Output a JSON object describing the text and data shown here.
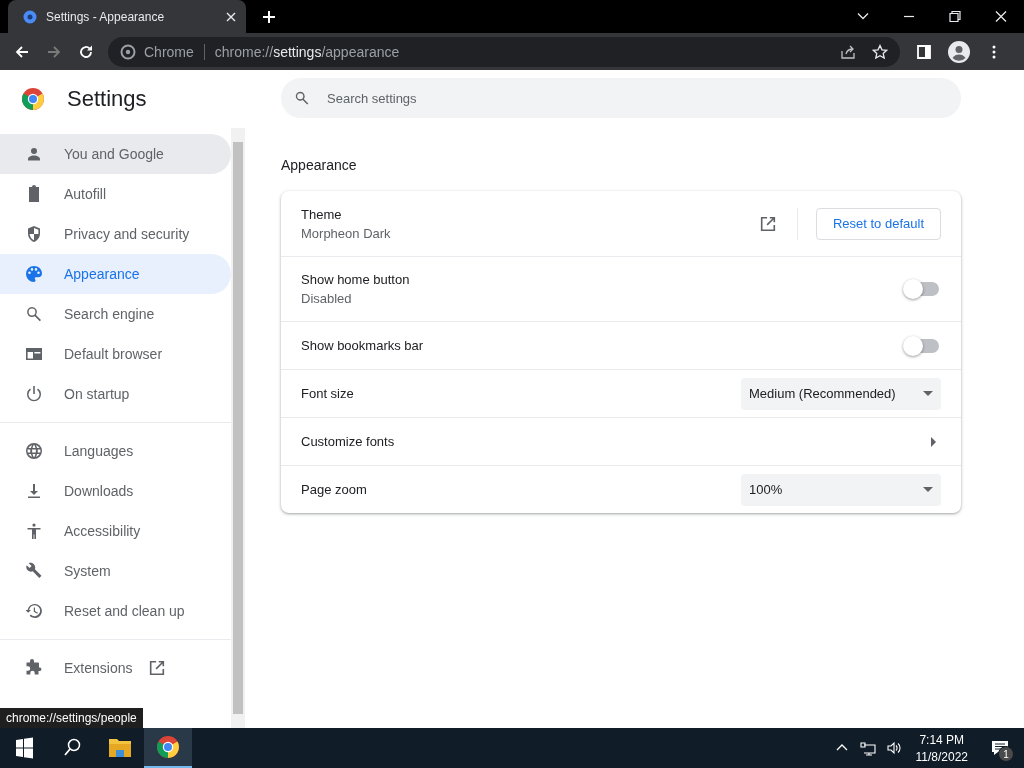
{
  "browser": {
    "tab": {
      "title": "Settings - Appearance"
    },
    "address_bar": {
      "chip": "Chrome",
      "url": {
        "scheme": "chrome://",
        "host": "settings",
        "path": "/appearance"
      }
    }
  },
  "sidebar": {
    "title": "Settings",
    "sections": [
      {
        "items": [
          {
            "label": "You and Google",
            "selected": false,
            "hovered": true
          },
          {
            "label": "Autofill",
            "selected": false,
            "hovered": false
          },
          {
            "label": "Privacy and security",
            "selected": false,
            "hovered": false
          },
          {
            "label": "Appearance",
            "selected": true,
            "hovered": false
          },
          {
            "label": "Search engine",
            "selected": false,
            "hovered": false
          },
          {
            "label": "Default browser",
            "selected": false,
            "hovered": false
          },
          {
            "label": "On startup",
            "selected": false,
            "hovered": false
          }
        ]
      },
      {
        "items": [
          {
            "label": "Languages",
            "selected": false,
            "hovered": false
          },
          {
            "label": "Downloads",
            "selected": false,
            "hovered": false
          },
          {
            "label": "Accessibility",
            "selected": false,
            "hovered": false
          },
          {
            "label": "System",
            "selected": false,
            "hovered": false
          },
          {
            "label": "Reset and clean up",
            "selected": false,
            "hovered": false
          }
        ]
      },
      {
        "items": [
          {
            "label": "Extensions",
            "selected": false,
            "hovered": false,
            "external": true
          }
        ]
      }
    ]
  },
  "search": {
    "placeholder": "Search settings"
  },
  "section_title": "Appearance",
  "rows": [
    {
      "kind": "theme",
      "label": "Theme",
      "sublabel": "Morpheon Dark",
      "button": "Reset to default"
    },
    {
      "kind": "toggle",
      "label": "Show home button",
      "sublabel": "Disabled",
      "on": false
    },
    {
      "kind": "toggle",
      "label": "Show bookmarks bar",
      "on": false
    },
    {
      "kind": "select",
      "label": "Font size",
      "value": "Medium (Recommended)"
    },
    {
      "kind": "submenu",
      "label": "Customize fonts"
    },
    {
      "kind": "select",
      "label": "Page zoom",
      "value": "100%"
    }
  ],
  "status_tooltip": "chrome://settings/people",
  "taskbar": {
    "time": "7:14 PM",
    "date": "11/8/2022",
    "notification_count": "1"
  }
}
